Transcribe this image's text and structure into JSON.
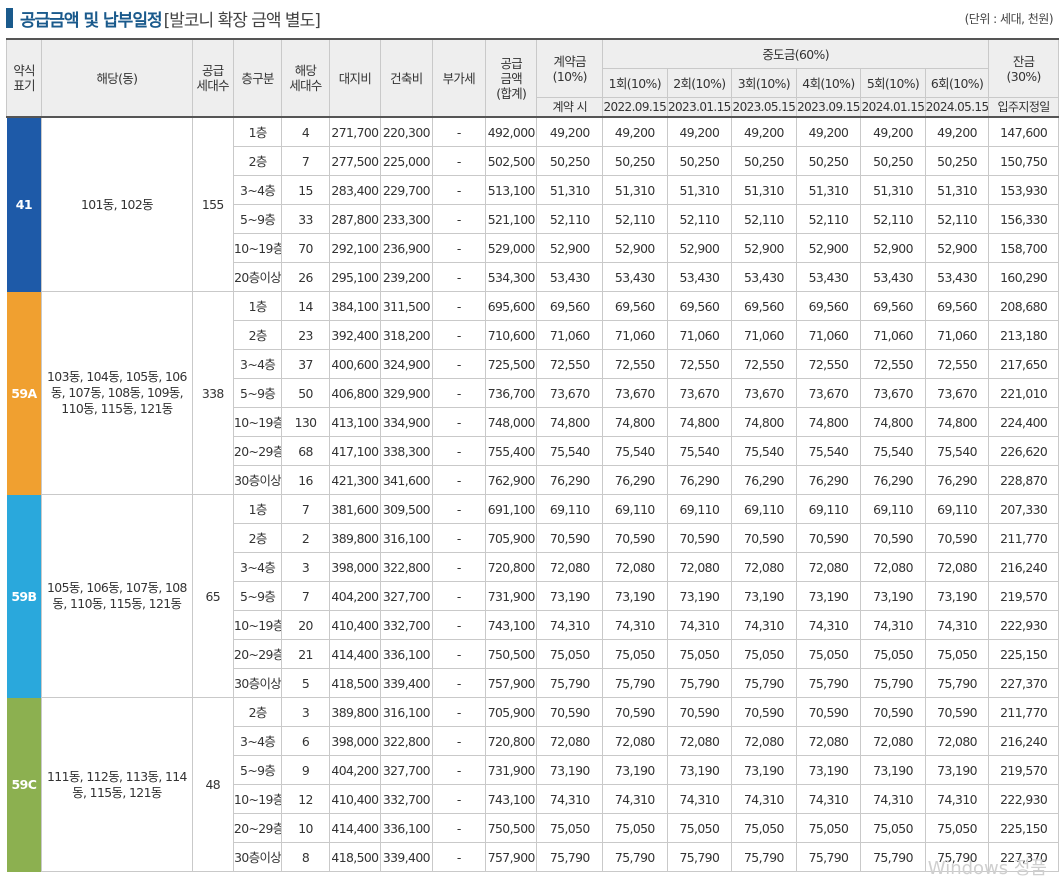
{
  "title": {
    "bold": "공급금액 및 납부일정",
    "sub": "[발코니 확장 금액 별도]",
    "unit": "(단위 : 세대, 천원)"
  },
  "headers": {
    "abbr": [
      "약식",
      "표기"
    ],
    "dong": "해당(동)",
    "supply_units": [
      "공급",
      "세대수"
    ],
    "floor": "층구분",
    "units": [
      "해당",
      "세대수"
    ],
    "land": "대지비",
    "building": "건축비",
    "vat": "부가세",
    "total": [
      "공급",
      "금액",
      "(합계)"
    ],
    "contract": [
      "계약금",
      "(10%)"
    ],
    "contract_when": "계약 시",
    "interim": "중도금(60%)",
    "installments": [
      "1회(10%)",
      "2회(10%)",
      "3회(10%)",
      "4회(10%)",
      "5회(10%)",
      "6회(10%)"
    ],
    "dates": [
      "2022.09.15",
      "2023.01.15",
      "2023.05.15",
      "2023.09.15",
      "2024.01.15",
      "2024.05.15"
    ],
    "balance": [
      "잔금",
      "(30%)"
    ],
    "balance_when": "입주지정일"
  },
  "groups": [
    {
      "type": "41",
      "color": "#1e5aa8",
      "dong": "101동, 102동",
      "supply": "155",
      "rows": [
        [
          "1층",
          "4",
          "271,700",
          "220,300",
          "-",
          "492,000",
          "49,200",
          "49,200",
          "49,200",
          "49,200",
          "49,200",
          "49,200",
          "49,200",
          "147,600"
        ],
        [
          "2층",
          "7",
          "277,500",
          "225,000",
          "-",
          "502,500",
          "50,250",
          "50,250",
          "50,250",
          "50,250",
          "50,250",
          "50,250",
          "50,250",
          "150,750"
        ],
        [
          "3~4층",
          "15",
          "283,400",
          "229,700",
          "-",
          "513,100",
          "51,310",
          "51,310",
          "51,310",
          "51,310",
          "51,310",
          "51,310",
          "51,310",
          "153,930"
        ],
        [
          "5~9층",
          "33",
          "287,800",
          "233,300",
          "-",
          "521,100",
          "52,110",
          "52,110",
          "52,110",
          "52,110",
          "52,110",
          "52,110",
          "52,110",
          "156,330"
        ],
        [
          "10~19층",
          "70",
          "292,100",
          "236,900",
          "-",
          "529,000",
          "52,900",
          "52,900",
          "52,900",
          "52,900",
          "52,900",
          "52,900",
          "52,900",
          "158,700"
        ],
        [
          "20층이상",
          "26",
          "295,100",
          "239,200",
          "-",
          "534,300",
          "53,430",
          "53,430",
          "53,430",
          "53,430",
          "53,430",
          "53,430",
          "53,430",
          "160,290"
        ]
      ]
    },
    {
      "type": "59A",
      "color": "#f0a030",
      "dong": "103동, 104동, 105동, 106동, 107동, 108동, 109동, 110동, 115동, 121동",
      "supply": "338",
      "rows": [
        [
          "1층",
          "14",
          "384,100",
          "311,500",
          "-",
          "695,600",
          "69,560",
          "69,560",
          "69,560",
          "69,560",
          "69,560",
          "69,560",
          "69,560",
          "208,680"
        ],
        [
          "2층",
          "23",
          "392,400",
          "318,200",
          "-",
          "710,600",
          "71,060",
          "71,060",
          "71,060",
          "71,060",
          "71,060",
          "71,060",
          "71,060",
          "213,180"
        ],
        [
          "3~4층",
          "37",
          "400,600",
          "324,900",
          "-",
          "725,500",
          "72,550",
          "72,550",
          "72,550",
          "72,550",
          "72,550",
          "72,550",
          "72,550",
          "217,650"
        ],
        [
          "5~9층",
          "50",
          "406,800",
          "329,900",
          "-",
          "736,700",
          "73,670",
          "73,670",
          "73,670",
          "73,670",
          "73,670",
          "73,670",
          "73,670",
          "221,010"
        ],
        [
          "10~19층",
          "130",
          "413,100",
          "334,900",
          "-",
          "748,000",
          "74,800",
          "74,800",
          "74,800",
          "74,800",
          "74,800",
          "74,800",
          "74,800",
          "224,400"
        ],
        [
          "20~29층",
          "68",
          "417,100",
          "338,300",
          "-",
          "755,400",
          "75,540",
          "75,540",
          "75,540",
          "75,540",
          "75,540",
          "75,540",
          "75,540",
          "226,620"
        ],
        [
          "30층이상",
          "16",
          "421,300",
          "341,600",
          "-",
          "762,900",
          "76,290",
          "76,290",
          "76,290",
          "76,290",
          "76,290",
          "76,290",
          "76,290",
          "228,870"
        ]
      ]
    },
    {
      "type": "59B",
      "color": "#2aa8dc",
      "dong": "105동, 106동, 107동, 108동, 110동, 115동, 121동",
      "supply": "65",
      "rows": [
        [
          "1층",
          "7",
          "381,600",
          "309,500",
          "-",
          "691,100",
          "69,110",
          "69,110",
          "69,110",
          "69,110",
          "69,110",
          "69,110",
          "69,110",
          "207,330"
        ],
        [
          "2층",
          "2",
          "389,800",
          "316,100",
          "-",
          "705,900",
          "70,590",
          "70,590",
          "70,590",
          "70,590",
          "70,590",
          "70,590",
          "70,590",
          "211,770"
        ],
        [
          "3~4층",
          "3",
          "398,000",
          "322,800",
          "-",
          "720,800",
          "72,080",
          "72,080",
          "72,080",
          "72,080",
          "72,080",
          "72,080",
          "72,080",
          "216,240"
        ],
        [
          "5~9층",
          "7",
          "404,200",
          "327,700",
          "-",
          "731,900",
          "73,190",
          "73,190",
          "73,190",
          "73,190",
          "73,190",
          "73,190",
          "73,190",
          "219,570"
        ],
        [
          "10~19층",
          "20",
          "410,400",
          "332,700",
          "-",
          "743,100",
          "74,310",
          "74,310",
          "74,310",
          "74,310",
          "74,310",
          "74,310",
          "74,310",
          "222,930"
        ],
        [
          "20~29층",
          "21",
          "414,400",
          "336,100",
          "-",
          "750,500",
          "75,050",
          "75,050",
          "75,050",
          "75,050",
          "75,050",
          "75,050",
          "75,050",
          "225,150"
        ],
        [
          "30층이상",
          "5",
          "418,500",
          "339,400",
          "-",
          "757,900",
          "75,790",
          "75,790",
          "75,790",
          "75,790",
          "75,790",
          "75,790",
          "75,790",
          "227,370"
        ]
      ]
    },
    {
      "type": "59C",
      "color": "#8cb050",
      "dong": "111동, 112동, 113동, 114동, 115동, 121동",
      "supply": "48",
      "rows": [
        [
          "2층",
          "3",
          "389,800",
          "316,100",
          "-",
          "705,900",
          "70,590",
          "70,590",
          "70,590",
          "70,590",
          "70,590",
          "70,590",
          "70,590",
          "211,770"
        ],
        [
          "3~4층",
          "6",
          "398,000",
          "322,800",
          "-",
          "720,800",
          "72,080",
          "72,080",
          "72,080",
          "72,080",
          "72,080",
          "72,080",
          "72,080",
          "216,240"
        ],
        [
          "5~9층",
          "9",
          "404,200",
          "327,700",
          "-",
          "731,900",
          "73,190",
          "73,190",
          "73,190",
          "73,190",
          "73,190",
          "73,190",
          "73,190",
          "219,570"
        ],
        [
          "10~19층",
          "12",
          "410,400",
          "332,700",
          "-",
          "743,100",
          "74,310",
          "74,310",
          "74,310",
          "74,310",
          "74,310",
          "74,310",
          "74,310",
          "222,930"
        ],
        [
          "20~29층",
          "10",
          "414,400",
          "336,100",
          "-",
          "750,500",
          "75,050",
          "75,050",
          "75,050",
          "75,050",
          "75,050",
          "75,050",
          "75,050",
          "225,150"
        ],
        [
          "30층이상",
          "8",
          "418,500",
          "339,400",
          "-",
          "757,900",
          "75,790",
          "75,790",
          "75,790",
          "75,790",
          "75,790",
          "75,790",
          "75,790",
          "227,370"
        ]
      ]
    }
  ],
  "watermark": "Windows 정품"
}
